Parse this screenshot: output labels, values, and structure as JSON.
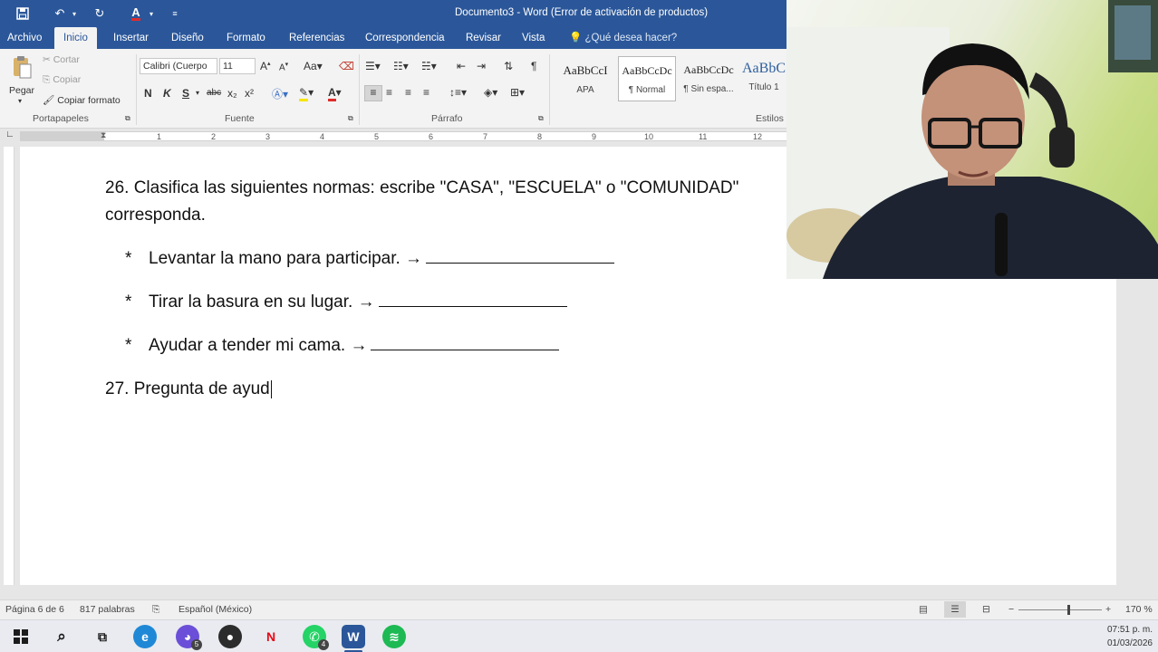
{
  "titlebar": {
    "title": "Documento3 - Word (Error de activación de productos)",
    "bg_color": "#2b579a"
  },
  "tabs": [
    {
      "label": "Archivo"
    },
    {
      "label": "Inicio"
    },
    {
      "label": "Insertar"
    },
    {
      "label": "Diseño"
    },
    {
      "label": "Formato"
    },
    {
      "label": "Referencias"
    },
    {
      "label": "Correspondencia"
    },
    {
      "label": "Revisar"
    },
    {
      "label": "Vista"
    }
  ],
  "tell_me": "¿Qué desea hacer?",
  "clipboard": {
    "paste": "Pegar",
    "cut": "Cortar",
    "copy": "Copiar",
    "format_painter": "Copiar formato",
    "group": "Portapapeles"
  },
  "font": {
    "name": "Calibri (Cuerpo",
    "size": "11",
    "change_case": "Aa",
    "bold": "N",
    "italic": "K",
    "underline": "S",
    "strike": "abc",
    "sub": "x₂",
    "sup": "x²",
    "group": "Fuente"
  },
  "paragraph": {
    "group": "Párrafo"
  },
  "styles": {
    "items": [
      {
        "sample": "AaBbCcI",
        "name": "APA"
      },
      {
        "sample": "AaBbCcDc",
        "name": "¶ Normal"
      },
      {
        "sample": "AaBbCcDc",
        "name": "¶ Sin espa..."
      },
      {
        "sample": "AaBbC",
        "name": "Título 1"
      }
    ],
    "group": "Estilos"
  },
  "ruler": {
    "numbers": [
      "1",
      "2",
      "3",
      "4",
      "5",
      "6",
      "7",
      "8",
      "9",
      "10",
      "11",
      "12"
    ]
  },
  "document": {
    "q26_line1": "26. Clasifica las siguientes normas: escribe \"CASA\", \"ESCUELA\" o \"COMUNIDAD\"",
    "q26_line2": "corresponda.",
    "bullet": "*",
    "items": [
      "Levantar la mano para participar. →",
      "Tirar la basura en su lugar. →",
      "Ayudar a tender mi cama. →"
    ],
    "q27": "27. Pregunta de ayud"
  },
  "statusbar": {
    "page": "Página 6 de 6",
    "words": "817 palabras",
    "language": "Español (México)",
    "zoom": "170 %"
  },
  "taskbar": {
    "icons": [
      "windows-start",
      "search",
      "task-view",
      "edge",
      "discord",
      "app",
      "netflix",
      "whatsapp",
      "word",
      "spotify"
    ],
    "badges": {
      "discord": "5",
      "whatsapp": "4"
    }
  },
  "clock": {
    "time": "07:51 p. m.",
    "date": "01/03/2026"
  }
}
